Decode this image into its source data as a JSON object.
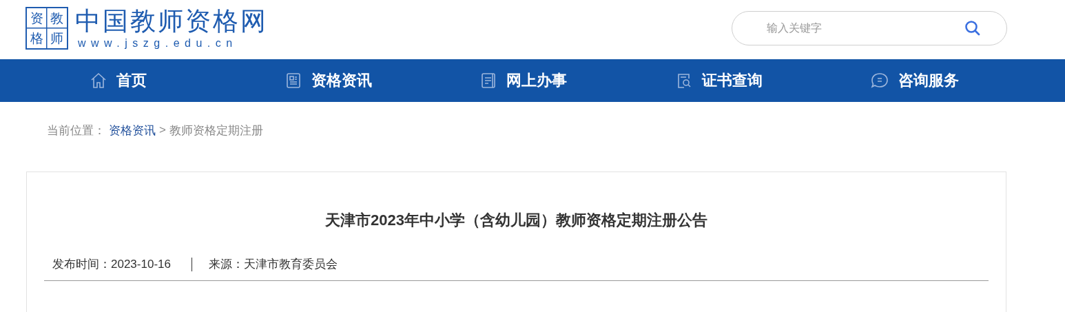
{
  "logo": {
    "badge": [
      "资",
      "教",
      "格",
      "师"
    ],
    "title": "中国教师资格网",
    "url": "www.jszg.edu.cn"
  },
  "search": {
    "placeholder": "输入关键字"
  },
  "nav": [
    {
      "label": "首页",
      "kind": "home"
    },
    {
      "label": "资格资讯",
      "kind": "news"
    },
    {
      "label": "网上办事",
      "kind": "book"
    },
    {
      "label": "证书查询",
      "kind": "query"
    },
    {
      "label": "咨询服务",
      "kind": "chat"
    }
  ],
  "breadcrumb": {
    "prefix": "当前位置：",
    "link": "资格资讯",
    "separator": ">",
    "current": "教师资格定期注册"
  },
  "article": {
    "title": "天津市2023年中小学（含幼儿园）教师资格定期注册公告",
    "date_label": "发布时间：",
    "date": "2023-10-16",
    "source_label": "来源：",
    "source": "天津市教育委员会"
  }
}
